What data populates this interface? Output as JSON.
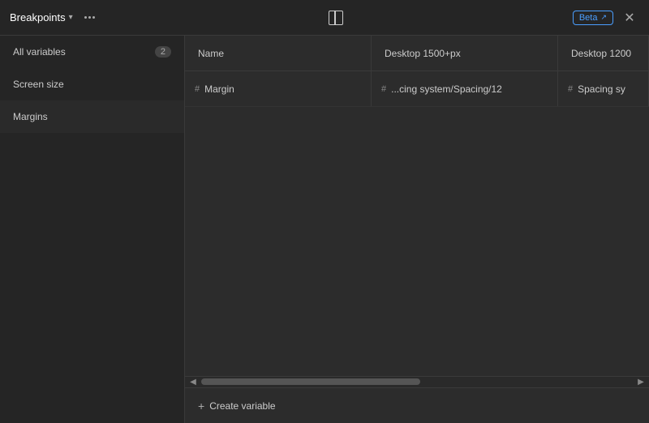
{
  "header": {
    "title": "Breakpoints",
    "chevron": "▾",
    "beta_label": "Beta",
    "external_icon": "↗",
    "close_icon": "✕"
  },
  "sidebar": {
    "items": [
      {
        "id": "all-variables",
        "label": "All variables",
        "badge": "2"
      },
      {
        "id": "screen-size",
        "label": "Screen size",
        "badge": null
      },
      {
        "id": "margins",
        "label": "Margins",
        "badge": null,
        "active": true
      }
    ]
  },
  "table": {
    "columns": [
      {
        "id": "name",
        "label": "Name"
      },
      {
        "id": "desktop1500",
        "label": "Desktop 1500+px"
      },
      {
        "id": "desktop1200",
        "label": "Desktop 1200"
      }
    ],
    "rows": [
      {
        "name": "Margin",
        "name_hash": "#",
        "desktop1500_hash": "#",
        "desktop1500_val": "...cing system/Spacing/12",
        "desktop1200_hash": "#",
        "desktop1200_val": "Spacing sy"
      }
    ]
  },
  "footer": {
    "create_variable_label": "Create variable",
    "plus_icon": "+"
  }
}
